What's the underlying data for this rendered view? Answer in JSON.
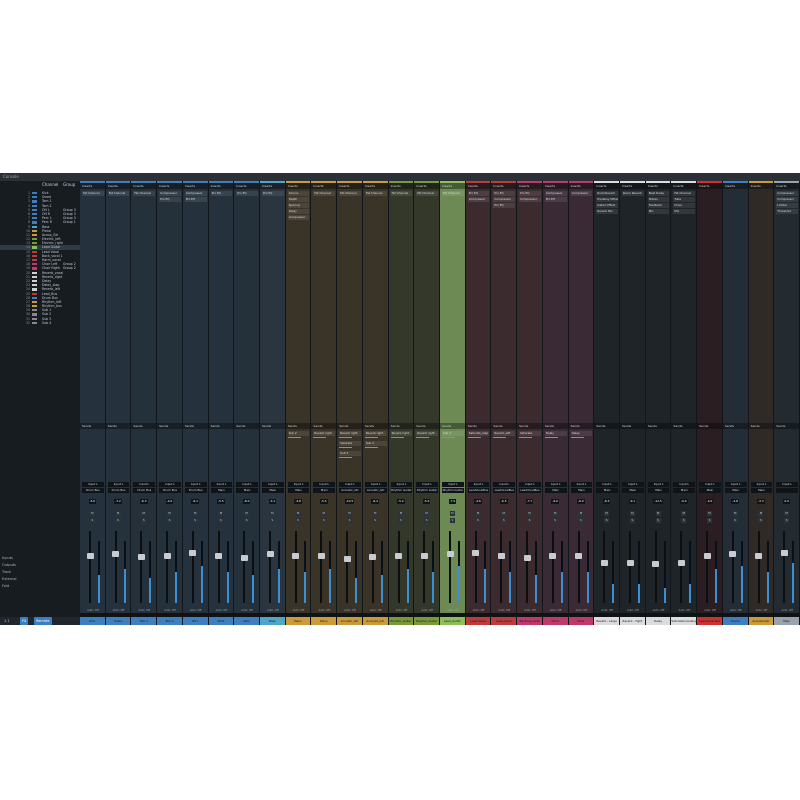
{
  "window": {
    "title": "Console"
  },
  "panel": {
    "col_header_channel": "Channel",
    "col_header_group": "Group",
    "side_buttons": [
      "Inputs",
      "Outputs",
      "Track",
      "External",
      "Fold"
    ],
    "bottom": {
      "pill_1": "FX",
      "pill_2": "Remote",
      "num": "1.1"
    }
  },
  "tracks": [
    {
      "n": "1",
      "name": "Kick",
      "color": "#3f7fbf",
      "group": ""
    },
    {
      "n": "2",
      "name": "Snare",
      "color": "#3f7fbf",
      "group": ""
    },
    {
      "n": "3",
      "name": "Tom 1",
      "color": "#3f7fbf",
      "group": ""
    },
    {
      "n": "4",
      "name": "Tom 2",
      "color": "#3f7fbf",
      "group": ""
    },
    {
      "n": "5",
      "name": "OH L",
      "color": "#3f7fbf",
      "group": "Group 3"
    },
    {
      "n": "6",
      "name": "OH R",
      "color": "#3f7fbf",
      "group": "Group 3"
    },
    {
      "n": "7",
      "name": "Perc L",
      "color": "#3f7fbf",
      "group": "Group 3"
    },
    {
      "n": "8",
      "name": "Perc R",
      "color": "#3f7fbf",
      "group": "Group 1"
    },
    {
      "n": "9",
      "name": "Bass",
      "color": "#4fa6c8",
      "group": ""
    },
    {
      "n": "10",
      "name": "Piano",
      "color": "#c99b3a",
      "group": ""
    },
    {
      "n": "11",
      "name": "Acous_Gtr",
      "color": "#c99b3a",
      "group": ""
    },
    {
      "n": "12",
      "name": "Electric_left",
      "color": "#7a9a3a",
      "group": ""
    },
    {
      "n": "13",
      "name": "Electric_right",
      "color": "#7a9a3a",
      "group": ""
    },
    {
      "n": "14",
      "name": "Lead Guitar",
      "color": "#8fbf5a",
      "group": ""
    },
    {
      "n": "15",
      "name": "Lead Vocal",
      "color": "#bf3a3a",
      "group": ""
    },
    {
      "n": "16",
      "name": "Back_vocal 1",
      "color": "#bf3a3a",
      "group": ""
    },
    {
      "n": "17",
      "name": "Harm_vocal",
      "color": "#bf3a3a",
      "group": ""
    },
    {
      "n": "18",
      "name": "Choir Left",
      "color": "#bf3a6a",
      "group": "Group 2"
    },
    {
      "n": "19",
      "name": "Choir Right",
      "color": "#bf3a6a",
      "group": "Group 2"
    },
    {
      "n": "20",
      "name": "Reverb_vocal",
      "color": "#cfcfcf",
      "group": ""
    },
    {
      "n": "21",
      "name": "Reverb_right",
      "color": "#cfcfcf",
      "group": ""
    },
    {
      "n": "22",
      "name": "Delay",
      "color": "#cfcfcf",
      "group": ""
    },
    {
      "n": "23",
      "name": "Delay_slap",
      "color": "#cfcfcf",
      "group": ""
    },
    {
      "n": "24",
      "name": "Reverb_left",
      "color": "#cfcfcf",
      "group": ""
    },
    {
      "n": "25",
      "name": "Lead_Bus",
      "color": "#cf3030",
      "group": ""
    },
    {
      "n": "26",
      "name": "Drum Bus",
      "color": "#3f7fbf",
      "group": ""
    },
    {
      "n": "27",
      "name": "Rhythm_left",
      "color": "#c99b3a",
      "group": ""
    },
    {
      "n": "28",
      "name": "Rhythm_bus",
      "color": "#c99b3a",
      "group": ""
    },
    {
      "n": "29",
      "name": "Sub 1",
      "color": "#8a8a8a",
      "group": ""
    },
    {
      "n": "30",
      "name": "Sub 2",
      "color": "#8a8a8a",
      "group": ""
    },
    {
      "n": "31",
      "name": "Sub 3",
      "color": "#8a8a8a",
      "group": ""
    },
    {
      "n": "32",
      "name": "Sub 4",
      "color": "#8a8a8a",
      "group": ""
    }
  ],
  "strips": [
    {
      "name": "Kick",
      "color": "#3f7fbf",
      "bg": "#25323d",
      "ins": [
        "Fat Channel"
      ],
      "sends": [],
      "out": "Drum Bus",
      "vol": "-5.6",
      "auto": "Auto: Off",
      "level": 0.45,
      "fader": 0.7
    },
    {
      "name": "Snare",
      "color": "#3f7fbf",
      "bg": "#25323d",
      "ins": [
        "Fat Channel"
      ],
      "sends": [],
      "out": "Drum Bus",
      "vol": "-7.2",
      "auto": "Auto: Off",
      "level": 0.55,
      "fader": 0.72
    },
    {
      "name": "Tom 1",
      "color": "#3f7fbf",
      "bg": "#24303a",
      "ins": [
        "Fat Channel"
      ],
      "sends": [],
      "out": "Drum Bus",
      "vol": "-6.3",
      "auto": "Auto: Off",
      "level": 0.4,
      "fader": 0.68
    },
    {
      "name": "Tom 2",
      "color": "#3f7fbf",
      "bg": "#24303a",
      "ins": [
        "Compressor",
        "Pro EQ"
      ],
      "sends": [],
      "out": "Drum Bus",
      "vol": "-4.0",
      "auto": "Auto: Off",
      "level": 0.5,
      "fader": 0.7
    },
    {
      "name": "OH L",
      "color": "#3f7fbf",
      "bg": "#25323d",
      "ins": [
        "Compressor",
        "Pro EQ"
      ],
      "sends": [],
      "out": "Drum Bus",
      "vol": "-6.1",
      "auto": "Auto: Off",
      "level": 0.6,
      "fader": 0.74
    },
    {
      "name": "OH R",
      "color": "#3f7fbf",
      "bg": "#25323d",
      "ins": [
        "Pro EQ"
      ],
      "sends": [],
      "out": "Main",
      "vol": "-5.5",
      "auto": "Auto: Off",
      "level": 0.5,
      "fader": 0.7
    },
    {
      "name": "Perc",
      "color": "#3f7fbf",
      "bg": "#24303a",
      "ins": [
        "Pro EQ"
      ],
      "sends": [],
      "out": "Main",
      "vol": "-8.0",
      "auto": "Auto: Off",
      "level": 0.45,
      "fader": 0.66
    },
    {
      "name": "Bass",
      "color": "#4fa6c8",
      "bg": "#2a3540",
      "ins": [
        "Pro EQ"
      ],
      "sends": [],
      "out": "Main",
      "vol": "-3.1",
      "auto": "Auto: Off",
      "level": 0.55,
      "fader": 0.72
    },
    {
      "name": "Piano",
      "color": "#c99b3a",
      "bg": "#3a3328",
      "ins": [
        "Chorus",
        "Depth",
        "Spacing",
        "Delay",
        "Compressor"
      ],
      "sends": [
        "Sub 2"
      ],
      "out": "Main",
      "vol": "-4.8",
      "auto": "Auto: Off",
      "level": 0.5,
      "fader": 0.7
    },
    {
      "name": "Piano",
      "color": "#c99b3a",
      "bg": "#3a3328",
      "ins": [
        "Fat Channel"
      ],
      "sends": [
        "Reverb right"
      ],
      "out": "Main",
      "vol": "-5.4",
      "auto": "Auto: Off",
      "level": 0.55,
      "fader": 0.7
    },
    {
      "name": "Acoustic_Gtr",
      "color": "#c99b3a",
      "bg": "#3a3328",
      "ins": [
        "Fat Channel"
      ],
      "sends": [
        "Reverb right",
        "Saturate",
        "Sub 3"
      ],
      "out": "Acoustic_Gtr",
      "vol": "-10.5",
      "auto": "Auto: Off",
      "level": 0.4,
      "fader": 0.65
    },
    {
      "name": "Acoustic_Gtr",
      "color": "#c99b3a",
      "bg": "#3a3328",
      "ins": [
        "Fat Channel"
      ],
      "sends": [
        "Reverb right",
        "Sub 3"
      ],
      "out": "Acoustic_Gtr",
      "vol": "-6.4",
      "auto": "Auto: Off",
      "level": 0.45,
      "fader": 0.68
    },
    {
      "name": "Rhythm_Guitar",
      "color": "#7a9a3a",
      "bg": "#34382a",
      "ins": [
        "Fat Channel"
      ],
      "sends": [
        "Reverb right"
      ],
      "out": "Rhythm Guitar",
      "vol": "-5.2",
      "auto": "Auto: Off",
      "level": 0.55,
      "fader": 0.7
    },
    {
      "name": "Rhythm_Guitar",
      "color": "#7a9a3a",
      "bg": "#34382a",
      "ins": [
        "Fat Channel"
      ],
      "sends": [
        "Reverb right"
      ],
      "out": "Rhythm Guitar",
      "vol": "-5.0",
      "auto": "Auto: Off",
      "level": 0.5,
      "fader": 0.7
    },
    {
      "name": "Lead_Guitar",
      "color": "#8fbf5a",
      "bg": "#6e8a54",
      "ins": [
        "Fat Channel"
      ],
      "sends": [
        "Sub 1"
      ],
      "out": "Rhythm Guitar",
      "vol": "-7.9",
      "auto": "Auto: Off",
      "level": 0.6,
      "fader": 0.72
    },
    {
      "name": "Lead Vocal",
      "color": "#bf3a3a",
      "bg": "#3b2b2f",
      "ins": [
        "Pro EQ",
        "Compressor"
      ],
      "sends": [
        "Saturate_step"
      ],
      "out": "LeadVocalBus",
      "vol": "-4.6",
      "auto": "Auto: Off",
      "level": 0.55,
      "fader": 0.73
    },
    {
      "name": "Lead_Vocal",
      "color": "#bf3a3a",
      "bg": "#3b2b2f",
      "ins": [
        "Pro EQ",
        "Compressor",
        "Pro EQ"
      ],
      "sends": [
        "Reverb_left"
      ],
      "out": "LeadVocalBus",
      "vol": "-6.5",
      "auto": "Auto: Off",
      "level": 0.5,
      "fader": 0.7
    },
    {
      "name": "Backing_vocal",
      "color": "#bf3a6a",
      "bg": "#3b2b2f",
      "ins": [
        "Pro EQ",
        "Compressor"
      ],
      "sends": [
        "Saturate"
      ],
      "out": "LeadVocalBus",
      "vol": "-7.7",
      "auto": "Auto: Off",
      "level": 0.45,
      "fader": 0.66
    },
    {
      "name": "Choir",
      "color": "#bf3a6a",
      "bg": "#3a2a35",
      "ins": [
        "Compressor",
        "Pro EQ"
      ],
      "sends": [
        "Delay"
      ],
      "out": "Main",
      "vol": "-6.0",
      "auto": "Auto: Off",
      "level": 0.5,
      "fader": 0.7
    },
    {
      "name": "Choir",
      "color": "#bf3a6a",
      "bg": "#3a2a35",
      "ins": [
        "Compressor"
      ],
      "sends": [
        "Delay"
      ],
      "out": "Main",
      "vol": "-6.0",
      "auto": "Auto: Off",
      "level": 0.5,
      "fader": 0.7
    },
    {
      "name": "Reverb - Large",
      "color": "#dcdcdc",
      "bg": "#1f2429",
      "ins": [
        "RoomReverb",
        "Predelay Offset",
        "Gated Offset",
        "Reverb Mix"
      ],
      "sends": [],
      "out": "Main",
      "vol": "-8.3",
      "auto": "Auto: Off",
      "level": 0.3,
      "fader": 0.6
    },
    {
      "name": "Reverb - Tight",
      "color": "#dcdcdc",
      "bg": "#1f2429",
      "ins": [
        "Room Reverb"
      ],
      "sends": [],
      "out": "Main",
      "vol": "-9.1",
      "auto": "Auto: Off",
      "level": 0.3,
      "fader": 0.6
    },
    {
      "name": "Delay",
      "color": "#dcdcdc",
      "bg": "#1f2429",
      "ins": [
        "Beat Delay",
        "Stereo",
        "Feedback",
        "Mix"
      ],
      "sends": [],
      "out": "Main",
      "vol": "-12.5",
      "auto": "Auto: Off",
      "level": 0.25,
      "fader": 0.58
    },
    {
      "name": "Saturation/Analog",
      "color": "#dcdcdc",
      "bg": "#1f2429",
      "ins": [
        "Fat Channel",
        "Tube",
        "Drive",
        "Mix"
      ],
      "sends": [],
      "out": "Main",
      "vol": "-9.0",
      "auto": "Auto: Off",
      "level": 0.3,
      "fader": 0.6
    },
    {
      "name": "Lead Vocal Bus",
      "color": "#cf3030",
      "bg": "#2a1e22",
      "ins": [],
      "sends": [],
      "out": "Main",
      "vol": "-4.0",
      "auto": "Auto: Off",
      "level": 0.55,
      "fader": 0.7
    },
    {
      "name": "Drums",
      "color": "#3f7fbf",
      "bg": "#242d36",
      "ins": [],
      "sends": [],
      "out": "Main",
      "vol": "-2.8",
      "auto": "Auto: Off",
      "level": 0.6,
      "fader": 0.72
    },
    {
      "name": "Acoustic/Gtr",
      "color": "#c99b3a",
      "bg": "#2f2a25",
      "ins": [],
      "sends": [],
      "out": "Main",
      "vol": "-3.3",
      "auto": "Auto: Off",
      "level": 0.5,
      "fader": 0.7
    },
    {
      "name": "Main",
      "color": "#9aa3ab",
      "bg": "#232a30",
      "ins": [
        "Compressor",
        "Compressor",
        "Limiter",
        "Threshold"
      ],
      "sends": [],
      "out": "",
      "vol": "0.0",
      "auto": "Auto: Off",
      "level": 0.65,
      "fader": 0.74
    }
  ]
}
